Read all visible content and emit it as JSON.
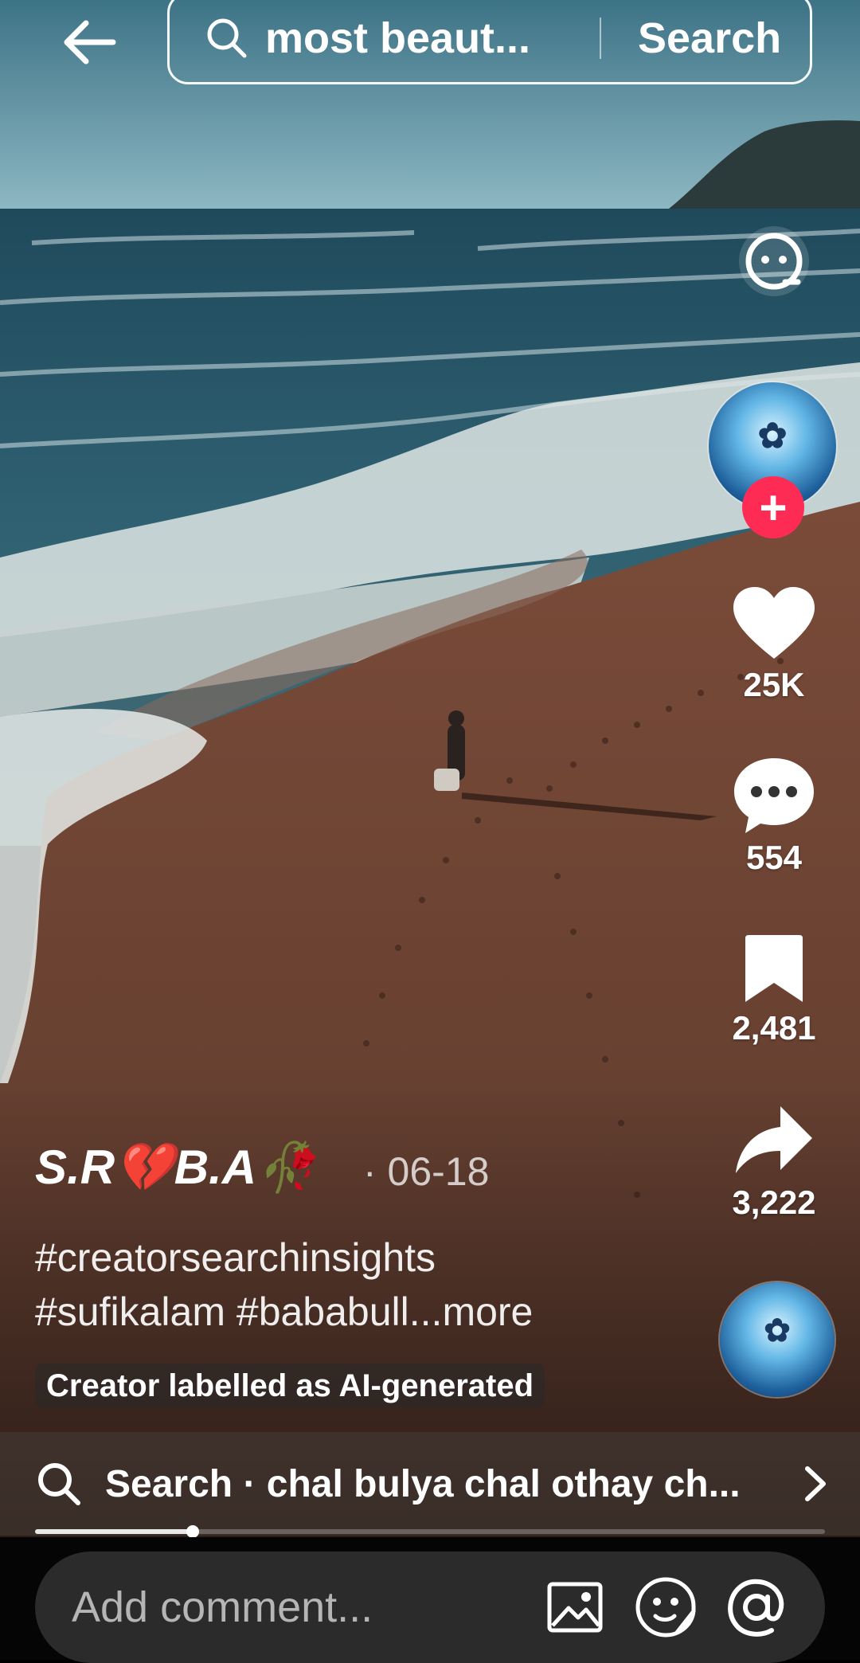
{
  "search": {
    "query": "most beaut...",
    "button_label": "Search"
  },
  "rail": {
    "likes": "25K",
    "comments": "554",
    "saves": "2,481",
    "shares": "3,222"
  },
  "post": {
    "author": "S.R💔B.A🥀",
    "date": "· 06-18",
    "hashtags_line1": "#creatorsearchinsights",
    "hashtags_line2": "#sufikalam #bababull",
    "more_label": "...more",
    "ai_label": "Creator labelled as AI-generated"
  },
  "related_search": {
    "text": "Search · chal bulya chal othay ch..."
  },
  "playback": {
    "progress": 0.2
  },
  "comment_bar": {
    "placeholder": "Add comment..."
  },
  "icons": {
    "back": "arrow-left-icon",
    "search": "search-icon",
    "ai_effect": "face-icon",
    "like": "heart-icon",
    "comment": "comment-bubble-icon",
    "save": "bookmark-icon",
    "share": "share-arrow-icon",
    "follow": "plus-icon",
    "chevron": "chevron-right-icon",
    "image": "image-icon",
    "sticker": "sticker-icon",
    "mention": "at-icon"
  },
  "colors": {
    "follow_button": "#fe2c55",
    "sea": "#2c5566",
    "sand": "#6b4333"
  }
}
